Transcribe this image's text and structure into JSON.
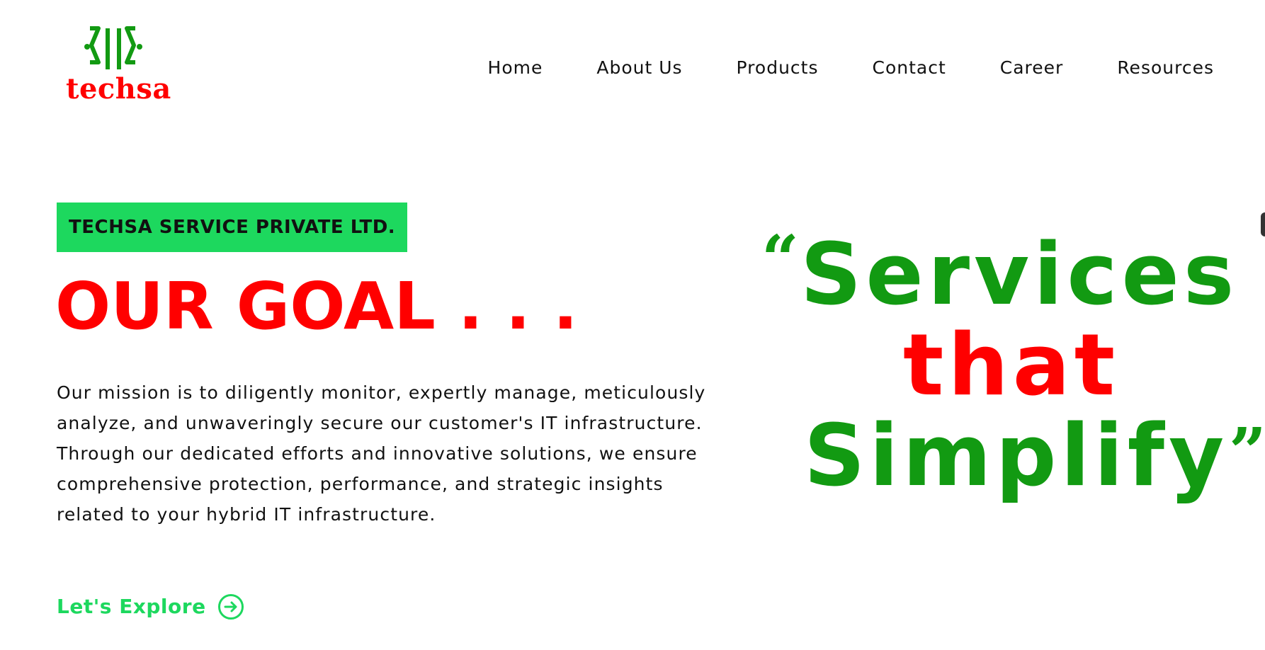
{
  "header": {
    "logo_text": "techsa",
    "logo_icon": "techsa-mark-icon",
    "nav": [
      {
        "label": "Home"
      },
      {
        "label": "About Us"
      },
      {
        "label": "Products"
      },
      {
        "label": "Contact"
      },
      {
        "label": "Career"
      },
      {
        "label": "Resources"
      }
    ]
  },
  "hero": {
    "company_badge": "TECHSA SERVICE PRIVATE LTD.",
    "title": "OUR GOAL . . .",
    "description": "Our mission is to diligently monitor, expertly manage, meticulously analyze, and unwaveringly secure our customer's IT infrastructure. Through our dedicated efforts and innovative solutions, we ensure comprehensive protection, performance, and strategic insights related to your hybrid IT infrastructure.",
    "cta_label": "Let's Explore",
    "cta_icon": "arrow-right-circle-icon"
  },
  "slogan": {
    "quote_open": "“",
    "line1": "Services",
    "line2": "that",
    "line3": "Simplify",
    "quote_close": "”"
  },
  "colors": {
    "brand_green": "#129a12",
    "accent_green": "#1dd85e",
    "brand_red": "#ff0000",
    "text": "#111111",
    "background": "#ffffff"
  }
}
